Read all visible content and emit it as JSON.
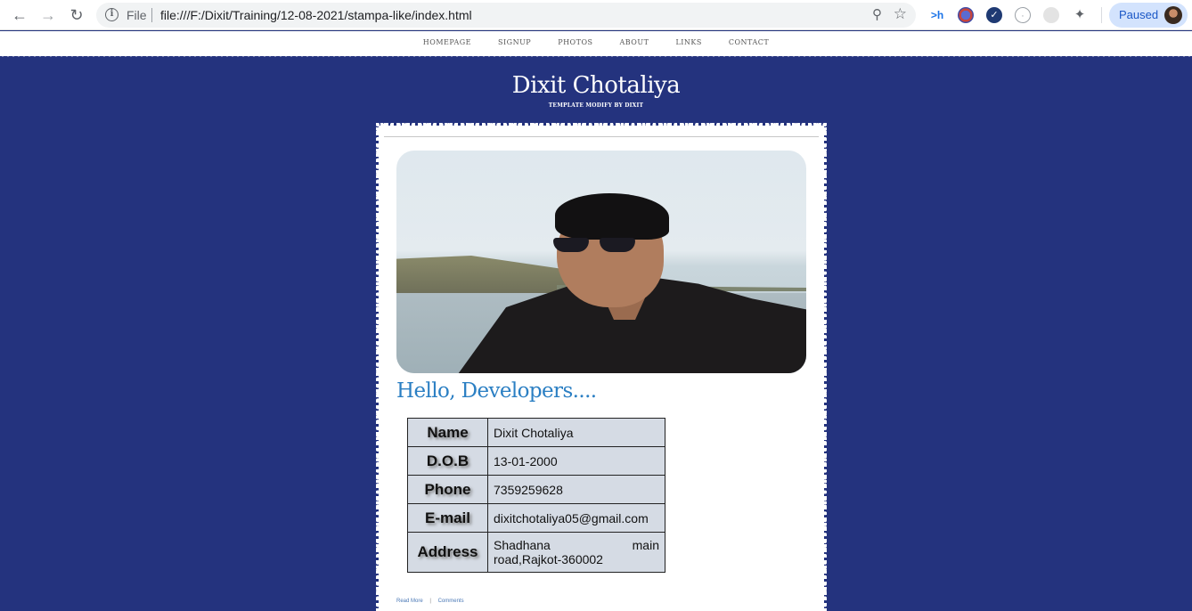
{
  "browser": {
    "url_scheme": "File",
    "url": "file:///F:/Dixit/Training/12-08-2021/stampa-like/index.html",
    "extensions": [
      ">h"
    ],
    "profile_status": "Paused"
  },
  "nav": {
    "items": [
      "HOMEPAGE",
      "SIGNUP",
      "PHOTOS",
      "ABOUT",
      "LINKS",
      "CONTACT"
    ]
  },
  "header": {
    "title": "Dixit Chotaliya",
    "subtitle": "TEMPLATE MODIFY BY DIXIT"
  },
  "post": {
    "heading": "Hello, Developers....",
    "rows": [
      {
        "label": "Name",
        "value": "Dixit Chotaliya"
      },
      {
        "label": "D.O.B",
        "value": "13-01-2000"
      },
      {
        "label": "Phone",
        "value": "7359259628"
      },
      {
        "label": "E-mail",
        "value": "dixitchotaliya05@gmail.com"
      },
      {
        "label": "Address",
        "value_line1_a": "Shadhana",
        "value_line1_b": "main",
        "value_line2": "road,Rajkot-360002"
      }
    ],
    "read_more": "Read More",
    "separator": "|",
    "comments": "Comments"
  },
  "colors": {
    "page_background": "#24337e",
    "heading_blue": "#2b7fc3",
    "table_background": "#d5dbe4"
  }
}
